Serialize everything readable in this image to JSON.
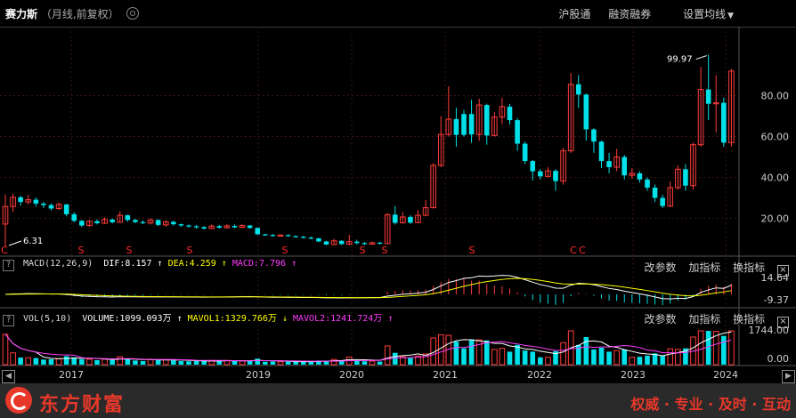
{
  "header": {
    "stock_name": "赛力斯",
    "mode": "（月线,前复权）",
    "links": [
      "沪股通",
      "融资融券",
      "设置均线"
    ]
  },
  "price_axis": {
    "ticks": [
      "80.00",
      "60.00",
      "40.00",
      "20.00"
    ]
  },
  "annotations": {
    "high": "99.97",
    "low": "6.31"
  },
  "markers": {
    "s": "S",
    "c": "C"
  },
  "macd": {
    "label": "MACD(12,26,9)",
    "dif": "DIF:8.157",
    "dea": "DEA:4.259",
    "macd": "MACD:7.796",
    "axis_top": "14.64",
    "axis_bottom": "-9.37"
  },
  "vol": {
    "label": "VOL(5,10)",
    "volume": "VOLUME:1099.093万",
    "mavol1": "MAVOL1:1329.766万",
    "mavol2": "MAVOL2:1241.724万",
    "axis_top": "1744.00",
    "axis_bottom": "0.00"
  },
  "panel_tools": [
    "改参数",
    "加指标",
    "换指标"
  ],
  "time_axis": [
    "2017",
    "2019",
    "2020",
    "2021",
    "2022",
    "2023",
    "2024"
  ],
  "footer": {
    "brand": "东方财富",
    "slogan": "权威 · 专业 · 及时 · 互动"
  },
  "colors": {
    "up": "#ff3b3b",
    "down": "#00e0e8",
    "dif": "#ffffff",
    "dea": "#ffff00",
    "macd_label": "#ff3cff",
    "footer_red": "#e8382a"
  },
  "candles": [
    [
      17.2,
      25.8,
      31.7,
      6.31,
      "u"
    ],
    [
      25.8,
      30.3,
      32.0,
      23.0,
      "u"
    ],
    [
      30.3,
      28.0,
      31.0,
      26.2,
      "d"
    ],
    [
      28.0,
      29.1,
      31.5,
      26.8,
      "u"
    ],
    [
      29.1,
      27.2,
      30.2,
      25.8,
      "d"
    ],
    [
      27.2,
      26.5,
      28.0,
      25.0,
      "d"
    ],
    [
      26.5,
      24.8,
      27.2,
      23.9,
      "d"
    ],
    [
      24.8,
      26.8,
      27.6,
      24.0,
      "u"
    ],
    [
      26.8,
      22.0,
      27.0,
      21.0,
      "d"
    ],
    [
      22.0,
      18.8,
      23.0,
      18.0,
      "d"
    ],
    [
      18.8,
      16.5,
      19.2,
      15.8,
      "d"
    ],
    [
      16.5,
      18.6,
      19.2,
      15.9,
      "u"
    ],
    [
      18.6,
      17.6,
      19.5,
      17.0,
      "d"
    ],
    [
      17.6,
      19.4,
      20.5,
      17.2,
      "u"
    ],
    [
      19.4,
      18.1,
      20.0,
      17.5,
      "d"
    ],
    [
      18.1,
      21.5,
      23.5,
      17.9,
      "u"
    ],
    [
      21.5,
      19.2,
      21.8,
      18.4,
      "d"
    ],
    [
      19.2,
      18.2,
      19.8,
      17.6,
      "d"
    ],
    [
      18.2,
      17.7,
      18.9,
      17.2,
      "d"
    ],
    [
      17.7,
      19.2,
      20.0,
      17.0,
      "u"
    ],
    [
      19.2,
      16.8,
      19.5,
      16.2,
      "d"
    ],
    [
      16.8,
      18.3,
      19.0,
      16.0,
      "u"
    ],
    [
      18.3,
      17.1,
      18.8,
      16.5,
      "d"
    ],
    [
      17.1,
      16.5,
      17.5,
      15.8,
      "d"
    ],
    [
      16.5,
      16.1,
      17.0,
      15.5,
      "d"
    ],
    [
      16.1,
      15.7,
      16.8,
      15.0,
      "d"
    ],
    [
      15.7,
      15.0,
      16.2,
      14.5,
      "d"
    ],
    [
      15.0,
      16.2,
      17.0,
      14.8,
      "u"
    ],
    [
      16.2,
      15.4,
      16.8,
      15.0,
      "d"
    ],
    [
      15.4,
      16.3,
      17.2,
      15.0,
      "u"
    ],
    [
      16.3,
      15.6,
      17.0,
      15.1,
      "d"
    ],
    [
      15.6,
      16.5,
      17.0,
      15.2,
      "u"
    ],
    [
      16.5,
      15.3,
      16.8,
      14.9,
      "d"
    ],
    [
      15.3,
      12.2,
      15.6,
      11.8,
      "d"
    ],
    [
      12.2,
      11.9,
      12.5,
      11.4,
      "d"
    ],
    [
      11.9,
      11.5,
      12.3,
      11.0,
      "d"
    ],
    [
      11.5,
      11.8,
      12.2,
      11.1,
      "u"
    ],
    [
      11.8,
      11.3,
      12.2,
      11.0,
      "d"
    ],
    [
      11.3,
      11.0,
      11.6,
      10.6,
      "d"
    ],
    [
      11.0,
      10.6,
      11.4,
      10.2,
      "d"
    ],
    [
      10.6,
      10.2,
      11.0,
      9.8,
      "d"
    ],
    [
      10.2,
      8.7,
      10.5,
      8.4,
      "d"
    ],
    [
      8.7,
      7.2,
      9.0,
      6.9,
      "d"
    ],
    [
      7.2,
      9.0,
      10.0,
      6.9,
      "u"
    ],
    [
      9.0,
      7.4,
      9.3,
      7.0,
      "d"
    ],
    [
      7.4,
      8.6,
      12.0,
      6.8,
      "u"
    ],
    [
      8.6,
      7.9,
      9.5,
      7.3,
      "d"
    ],
    [
      7.9,
      7.4,
      8.5,
      7.0,
      "d"
    ],
    [
      7.4,
      8.1,
      8.6,
      7.0,
      "u"
    ],
    [
      8.1,
      7.6,
      8.4,
      7.2,
      "d"
    ],
    [
      7.6,
      21.8,
      22.5,
      7.4,
      "u"
    ],
    [
      21.8,
      17.8,
      26.0,
      17.0,
      "d"
    ],
    [
      17.8,
      20.7,
      23.0,
      17.5,
      "u"
    ],
    [
      20.7,
      17.9,
      21.5,
      17.2,
      "d"
    ],
    [
      17.9,
      21.5,
      24.0,
      17.8,
      "u"
    ],
    [
      21.5,
      25.2,
      29.0,
      21.0,
      "u"
    ],
    [
      25.2,
      45.9,
      47.0,
      24.8,
      "u"
    ],
    [
      45.9,
      61.0,
      70.0,
      45.0,
      "u"
    ],
    [
      61.0,
      68.5,
      84.5,
      60.0,
      "u"
    ],
    [
      68.5,
      60.8,
      74.0,
      55.0,
      "d"
    ],
    [
      60.8,
      71.0,
      73.0,
      60.0,
      "d"
    ],
    [
      71.0,
      61.0,
      78.0,
      57.0,
      "d"
    ],
    [
      61.0,
      75.4,
      78.5,
      58.0,
      "u"
    ],
    [
      75.4,
      60.5,
      76.0,
      56.0,
      "d"
    ],
    [
      60.5,
      69.5,
      72.0,
      60.0,
      "u"
    ],
    [
      69.5,
      74.6,
      79.0,
      66.0,
      "u"
    ],
    [
      74.6,
      68.0,
      76.0,
      66.0,
      "d"
    ],
    [
      68.0,
      56.5,
      69.0,
      53.0,
      "d"
    ],
    [
      56.5,
      48.0,
      57.5,
      46.5,
      "d"
    ],
    [
      48.0,
      43.0,
      48.5,
      38.5,
      "d"
    ],
    [
      43.0,
      40.5,
      44.0,
      39.0,
      "d"
    ],
    [
      40.5,
      43.2,
      45.0,
      40.0,
      "u"
    ],
    [
      43.2,
      38.2,
      44.0,
      33.5,
      "d"
    ],
    [
      38.2,
      53.0,
      54.5,
      36.5,
      "u"
    ],
    [
      53.0,
      85.5,
      91.0,
      52.0,
      "u"
    ],
    [
      85.5,
      80.5,
      90.0,
      74.0,
      "d"
    ],
    [
      80.5,
      63.5,
      81.0,
      58.0,
      "d"
    ],
    [
      63.5,
      57.5,
      64.0,
      52.0,
      "d"
    ],
    [
      57.5,
      48.0,
      58.0,
      44.5,
      "d"
    ],
    [
      48.0,
      45.0,
      52.0,
      42.0,
      "d"
    ],
    [
      45.0,
      50.0,
      54.0,
      43.0,
      "u"
    ],
    [
      50.0,
      41.0,
      51.0,
      39.0,
      "d"
    ],
    [
      41.0,
      42.0,
      44.5,
      39.5,
      "u"
    ],
    [
      42.0,
      39.0,
      43.0,
      37.5,
      "d"
    ],
    [
      39.0,
      35.0,
      40.0,
      33.5,
      "d"
    ],
    [
      35.0,
      30.0,
      36.5,
      28.0,
      "d"
    ],
    [
      30.0,
      26.0,
      31.5,
      25.0,
      "d"
    ],
    [
      26.0,
      35.0,
      38.0,
      25.5,
      "u"
    ],
    [
      35.0,
      44.0,
      46.0,
      34.0,
      "u"
    ],
    [
      44.0,
      36.0,
      46.5,
      33.5,
      "d"
    ],
    [
      36.0,
      56.0,
      57.0,
      34.0,
      "u"
    ],
    [
      56.0,
      83.0,
      94.0,
      55.0,
      "u"
    ],
    [
      83.0,
      76.0,
      99.97,
      68.0,
      "d"
    ],
    [
      76.0,
      76.5,
      90.0,
      62.0,
      "u"
    ],
    [
      76.5,
      57.0,
      79.0,
      55.0,
      "d"
    ],
    [
      57.0,
      92.0,
      93.0,
      55.0,
      "u"
    ]
  ]
}
